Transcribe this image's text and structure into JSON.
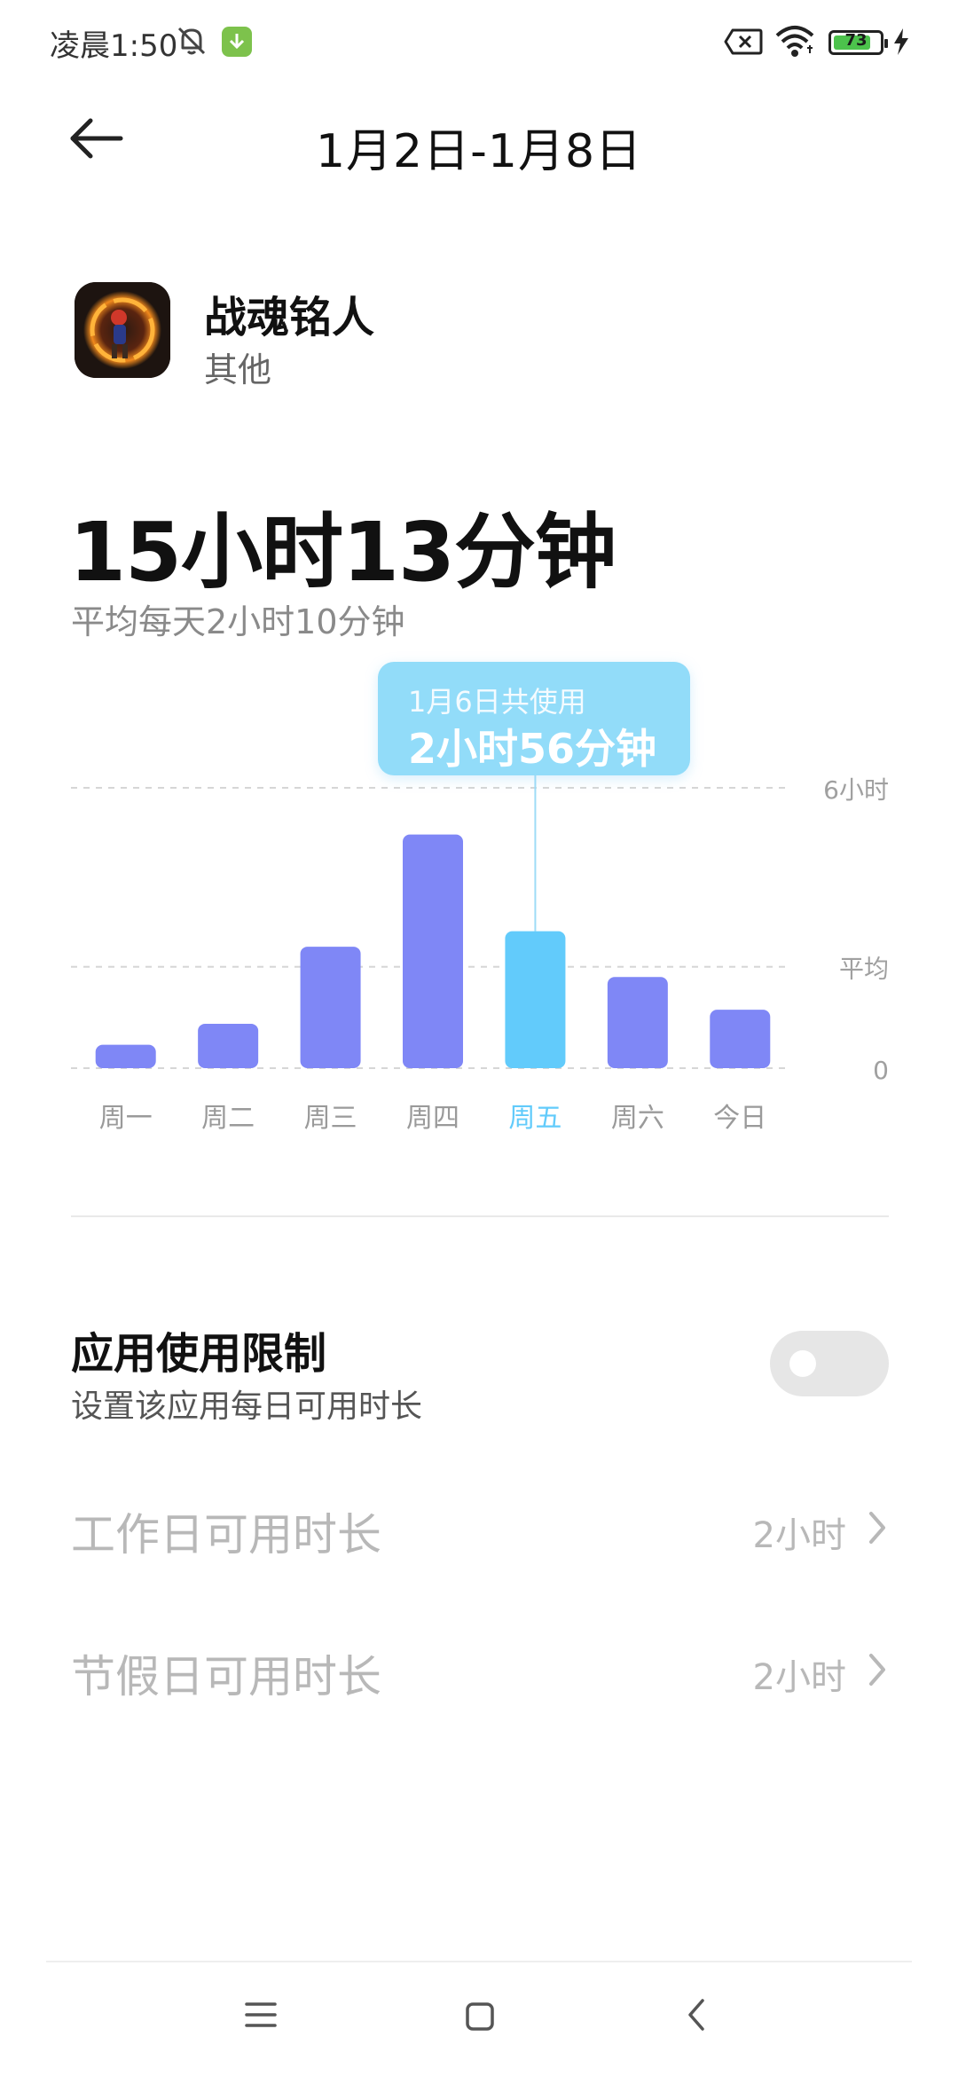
{
  "status_bar": {
    "time": "凌晨1:50",
    "battery": "73",
    "icons": [
      "mute-icon",
      "download-icon",
      "sim-off-icon",
      "wifi-icon",
      "battery-icon",
      "charging-icon"
    ]
  },
  "header": {
    "title": "1月2日-1月8日",
    "back_icon": "arrow-left-icon"
  },
  "app": {
    "name": "战魂铭人",
    "category": "其他"
  },
  "summary": {
    "total": "15小时13分钟",
    "average": "平均每天2小时10分钟"
  },
  "tooltip": {
    "title": "1月6日共使用",
    "value": "2小时56分钟"
  },
  "chart_data": {
    "type": "bar",
    "categories": [
      "周一",
      "周二",
      "周三",
      "周四",
      "周五",
      "周六",
      "今日"
    ],
    "values_hours": [
      0.5,
      0.95,
      2.6,
      5.0,
      2.93,
      1.95,
      1.25
    ],
    "selected_index": 4,
    "ylim_hours": [
      0,
      6
    ],
    "average_hours": 2.17,
    "y_tick_labels": [
      "6小时",
      "平均",
      "0"
    ],
    "colors": {
      "bar": "#7f87f6",
      "selected_bar": "#62cbfb",
      "selected_label": "#62cbfb",
      "label": "#9a9a9a",
      "gridline": "#d6d6d6"
    }
  },
  "limit": {
    "title": "应用使用限制",
    "subtitle": "设置该应用每日可用时长",
    "enabled": false,
    "rows": [
      {
        "label": "工作日可用时长",
        "value": "2小时"
      },
      {
        "label": "节假日可用时长",
        "value": "2小时"
      }
    ]
  },
  "nav_bar": {
    "icons": [
      "menu-icon",
      "home-icon",
      "back-icon"
    ]
  }
}
